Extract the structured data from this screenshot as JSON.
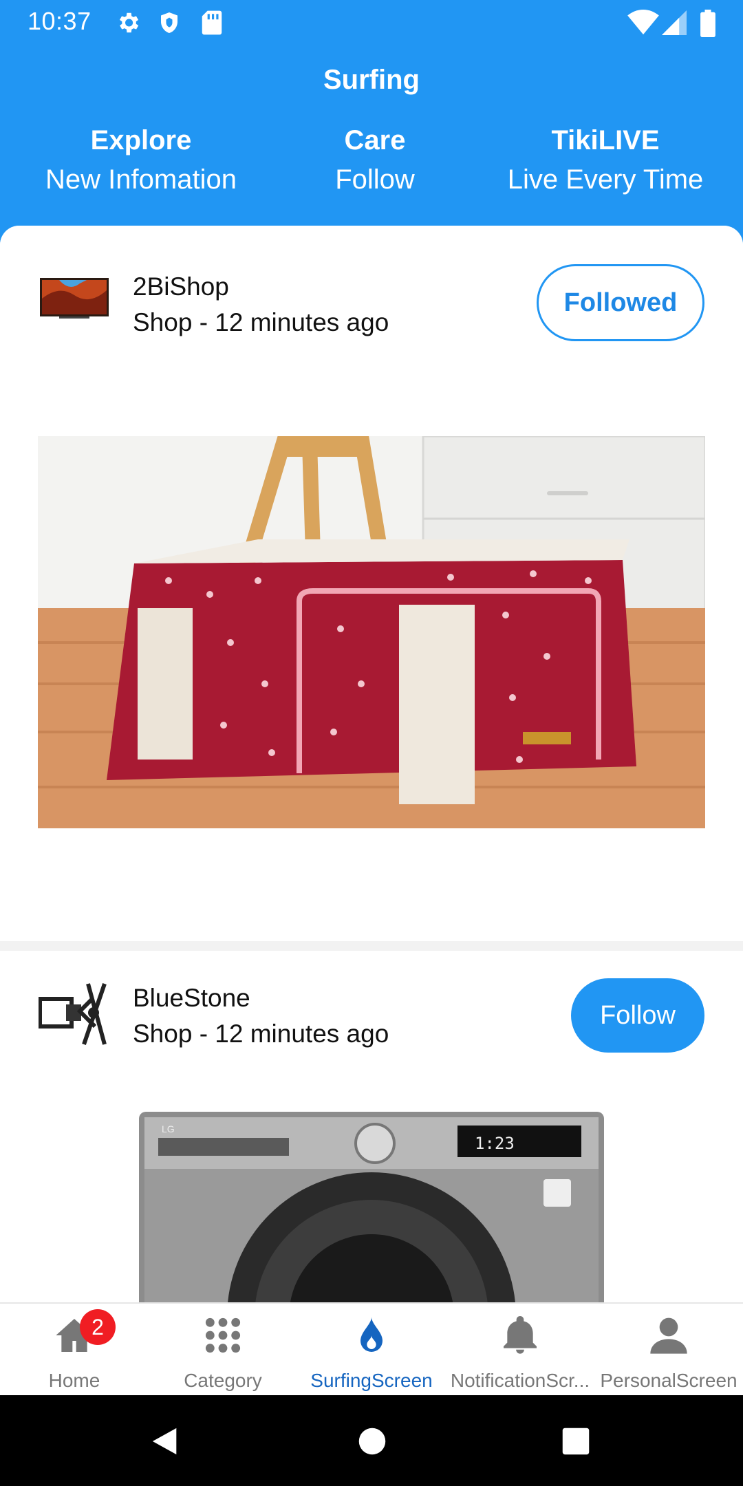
{
  "status_bar": {
    "time": "10:37",
    "left_icons": [
      "gear-icon",
      "shield-icon",
      "sd-card-icon"
    ],
    "right_icons": [
      "wifi-icon",
      "cell-signal-icon",
      "battery-icon"
    ]
  },
  "header": {
    "title": "Surfing",
    "tabs": [
      {
        "title": "Explore",
        "subtitle": "New Infomation"
      },
      {
        "title": "Care",
        "subtitle": "Follow"
      },
      {
        "title": "TikiLIVE",
        "subtitle": "Live Every Time"
      }
    ]
  },
  "posts": [
    {
      "shop_name": "2BiShop",
      "meta": "Shop - 12 minutes ago",
      "button_label": "Followed",
      "image": "red-polka-dot-storage-box-photo"
    },
    {
      "shop_name": "BlueStone",
      "meta": "Shop - 12 minutes ago",
      "button_label": "Follow",
      "image": "lg-washing-machine-photo"
    }
  ],
  "bottom_nav": {
    "items": [
      {
        "label": "Home",
        "icon": "home-icon",
        "badge": "2"
      },
      {
        "label": "Category",
        "icon": "grid-dots-icon"
      },
      {
        "label": "SurfingScreen",
        "icon": "flame-drop-icon"
      },
      {
        "label": "NotificationScr...",
        "icon": "bell-icon"
      },
      {
        "label": "PersonalScreen",
        "icon": "person-icon"
      }
    ],
    "active": "SurfingScreen"
  },
  "colors": {
    "primary": "#2196f3",
    "badge": "#f01d23",
    "active_nav": "#1565c0"
  }
}
